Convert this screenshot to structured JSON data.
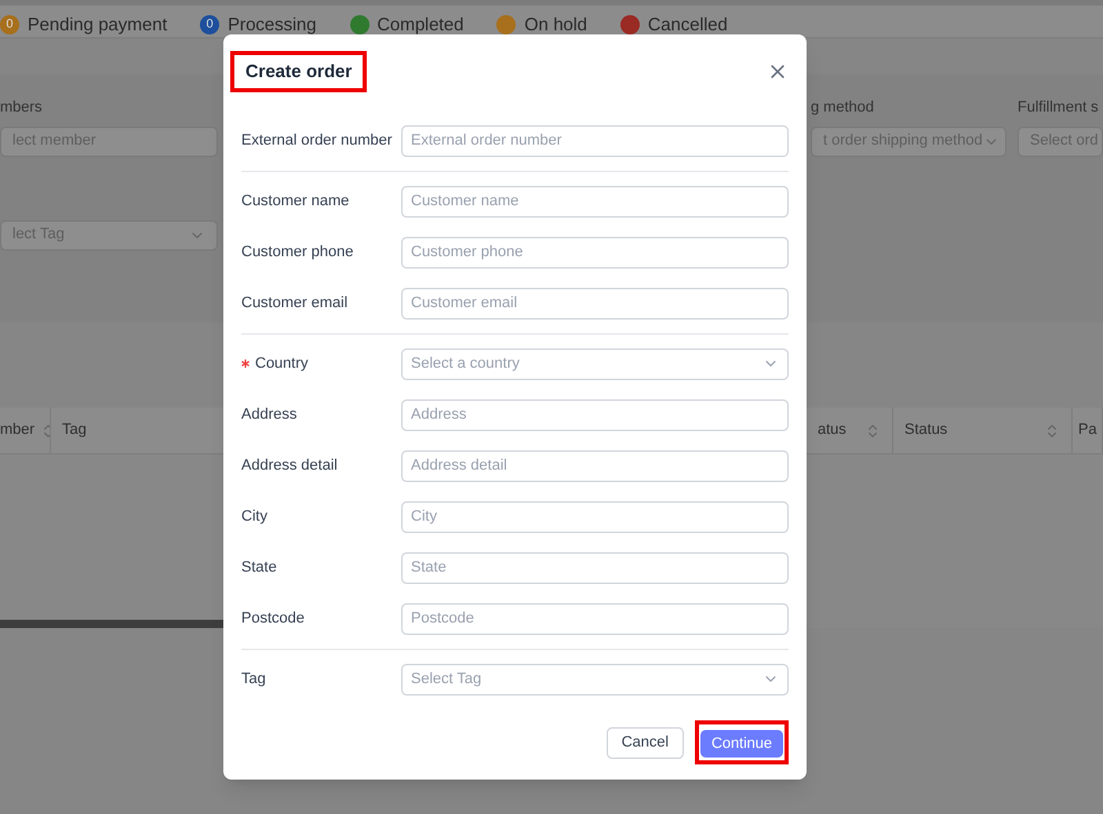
{
  "tabs": [
    {
      "label": "Pending payment",
      "count": "0",
      "color": "#a86f1c"
    },
    {
      "label": "Processing",
      "count": "0",
      "color": "#1d4f9c"
    },
    {
      "label": "Completed",
      "color": "#2f7a2f"
    },
    {
      "label": "On hold",
      "color": "#a86f1c"
    },
    {
      "label": "Cancelled",
      "color": "#9a2a24"
    }
  ],
  "filters": [
    {
      "label": "mbers",
      "placeholder": "lect member",
      "kind": "input"
    },
    {
      "label": "g method",
      "placeholder": "t order shipping method",
      "kind": "select"
    },
    {
      "label": "Fulfillment s",
      "placeholder": "Select ord",
      "kind": "input"
    }
  ],
  "tag_filter": {
    "placeholder": "lect Tag"
  },
  "table": {
    "columns": [
      {
        "label": "mber",
        "sortable": true
      },
      {
        "label": "Tag",
        "sortable": false
      },
      {
        "label": "atus",
        "sortable": true
      },
      {
        "label": "Status",
        "sortable": true
      },
      {
        "label": "Pa",
        "sortable": false
      }
    ]
  },
  "dialog": {
    "title": "Create order",
    "sections": [
      [
        {
          "label": "External order number",
          "placeholder": "External order number",
          "kind": "input",
          "required": false
        }
      ],
      [
        {
          "label": "Customer name",
          "placeholder": "Customer name",
          "kind": "input",
          "required": false
        },
        {
          "label": "Customer phone",
          "placeholder": "Customer phone",
          "kind": "input",
          "required": false
        },
        {
          "label": "Customer email",
          "placeholder": "Customer email",
          "kind": "input",
          "required": false
        }
      ],
      [
        {
          "label": "Country",
          "placeholder": "Select a country",
          "kind": "select",
          "required": true
        },
        {
          "label": "Address",
          "placeholder": "Address",
          "kind": "input",
          "required": false
        },
        {
          "label": "Address detail",
          "placeholder": "Address detail",
          "kind": "input",
          "required": false
        },
        {
          "label": "City",
          "placeholder": "City",
          "kind": "input",
          "required": false
        },
        {
          "label": "State",
          "placeholder": "State",
          "kind": "input",
          "required": false
        },
        {
          "label": "Postcode",
          "placeholder": "Postcode",
          "kind": "input",
          "required": false
        }
      ],
      [
        {
          "label": "Tag",
          "placeholder": "Select Tag",
          "kind": "select",
          "required": false
        }
      ]
    ],
    "buttons": [
      {
        "label": "Cancel",
        "kind": "secondary"
      },
      {
        "label": "Continue",
        "kind": "primary"
      }
    ]
  }
}
